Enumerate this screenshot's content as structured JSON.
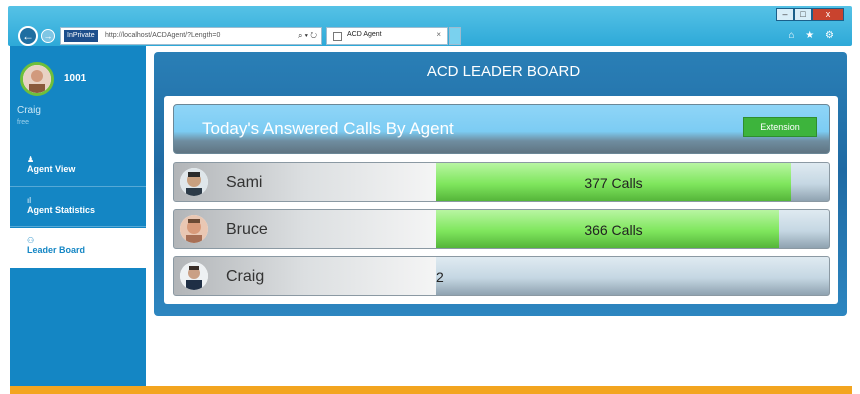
{
  "browser": {
    "inprivate_label": "InPrivate",
    "url": "http://localhost/ACDAgent/?Length=0",
    "tab_title": "ACD Agent",
    "tab_close": "×",
    "back_glyph": "←",
    "forward_glyph": "→",
    "search_refresh_glyphs": "⌕ ▾ ↻",
    "right_icons": "⌂ ★ ⚙",
    "window_buttons": {
      "minimize": "–",
      "maximize": "□",
      "close": "x"
    }
  },
  "sidebar": {
    "extension": "1001",
    "user_name": "Craig",
    "user_status": "free",
    "items": [
      {
        "label": "Agent View",
        "icon": "person-icon",
        "glyph": "♟"
      },
      {
        "label": "Agent Statistics",
        "icon": "bar-chart-icon",
        "glyph": "ıl"
      },
      {
        "label": "Leader Board",
        "icon": "group-icon",
        "glyph": "⚇"
      }
    ]
  },
  "board": {
    "title": "ACD LEADER BOARD",
    "header": "Today's Answered Calls By Agent",
    "extension_button": "Extension",
    "rows": [
      {
        "name": "Sami",
        "calls_label": "377 Calls",
        "calls": 377,
        "fill": 0.9
      },
      {
        "name": "Bruce",
        "calls_label": "366 Calls",
        "calls": 366,
        "fill": 0.87
      },
      {
        "name": "Craig",
        "calls_label": "2",
        "calls": 2,
        "fill": 0.0
      }
    ]
  },
  "colors": {
    "sidebar": "#1486c4",
    "accent_green": "#3db43c",
    "footer": "#f3a520",
    "panel_blue": "#1f6aa3"
  }
}
